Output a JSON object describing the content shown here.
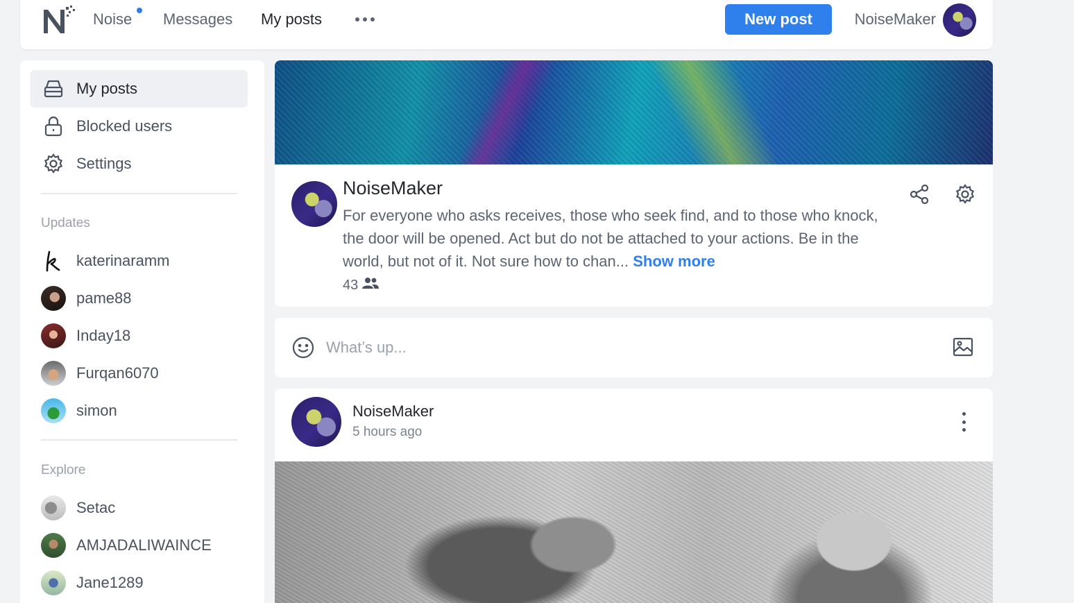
{
  "colors": {
    "accent": "#2f80ed",
    "notification_dot": "#2e7de9",
    "background": "#f2f3f5"
  },
  "topbar": {
    "logo_icon": "noise-logo-icon",
    "nav": [
      {
        "label": "Noise",
        "has_dot": true
      },
      {
        "label": "Messages",
        "has_dot": false
      },
      {
        "label": "My posts",
        "has_dot": false
      }
    ],
    "more_icon": "more-horizontal-icon",
    "new_post_label": "New post",
    "username": "NoiseMaker"
  },
  "sidebar": {
    "menu": [
      {
        "label": "My posts",
        "icon": "drawer-icon",
        "active": true
      },
      {
        "label": "Blocked users",
        "icon": "lock-icon",
        "active": false
      },
      {
        "label": "Settings",
        "icon": "gear-icon",
        "active": false
      }
    ],
    "updates_title": "Updates",
    "updates": [
      {
        "name": "katerinaramm"
      },
      {
        "name": "pame88"
      },
      {
        "name": "Inday18"
      },
      {
        "name": "Furqan6070"
      },
      {
        "name": "simon"
      }
    ],
    "explore_title": "Explore",
    "explore": [
      {
        "name": "Setac"
      },
      {
        "name": "AMJADALIWAINCE"
      },
      {
        "name": "Jane1289"
      }
    ]
  },
  "profile": {
    "name": "NoiseMaker",
    "bio": "For everyone who asks receives, those who seek find, and to those who knock, the door will be opened. Act but do not be attached to your actions. Be in the world, but not of it. Not sure how to chan...",
    "show_more": "Show more",
    "followers": "43",
    "followers_icon": "people-icon",
    "share_icon": "share-icon",
    "settings_icon": "gear-icon"
  },
  "compose": {
    "placeholder": "What’s up...",
    "emoji_icon": "smiley-icon",
    "image_icon": "image-icon"
  },
  "post": {
    "author": "NoiseMaker",
    "time": "5 hours ago",
    "menu_icon": "more-vertical-icon"
  }
}
